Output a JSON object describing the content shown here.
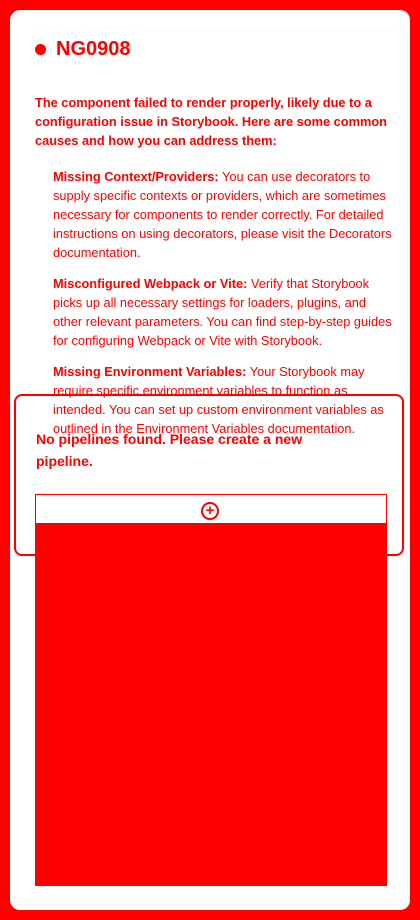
{
  "error": {
    "code": "NG0908",
    "intro": "The component failed to render properly, likely due to a configuration issue in Storybook. Here are some common causes and how you can address them:",
    "causes": [
      {
        "title": "Missing Context/Providers:",
        "text": " You can use decorators to supply specific contexts or providers, which are sometimes necessary for components to render correctly. For detailed instructions on using decorators, please visit the Decorators documentation."
      },
      {
        "title": "Misconfigured Webpack or Vite:",
        "text": " Verify that Storybook picks up all necessary settings for loaders, plugins, and other relevant parameters. You can find step-by-step guides for configuring Webpack or Vite with Storybook."
      },
      {
        "title": "Missing Environment Variables:",
        "text": " Your Storybook may require specific environment variables to function as intended. You can set up custom environment variables as outlined in the Environment Variables documentation."
      }
    ]
  },
  "pipelines": {
    "empty_message": "No pipelines found. Please create a new pipeline.",
    "add_icon": "plus-circle-icon"
  },
  "colors": {
    "accent": "#ff0000",
    "background": "#ffffff"
  }
}
